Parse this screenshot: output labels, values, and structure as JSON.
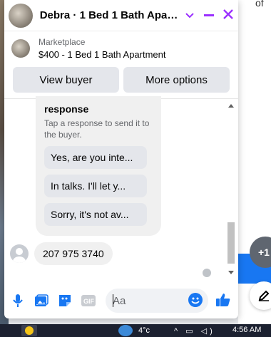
{
  "header": {
    "title": "Debra · 1 Bed 1 Bath Apart…"
  },
  "listing": {
    "label": "Marketplace",
    "title": "$400 - 1 Bed 1 Bath Apartment"
  },
  "actions": {
    "view_buyer": "View buyer",
    "more_options": "More options"
  },
  "bot_card": {
    "title": "response",
    "description": "Tap a response to send it to the buyer.",
    "replies": [
      "Yes, are you inte...",
      "In talks. I'll let y...",
      "Sorry, it's not av..."
    ]
  },
  "message": {
    "text": "207 975 3740"
  },
  "composer": {
    "placeholder": "Aa"
  },
  "right_panel": {
    "partial_text": "of",
    "new_badge": "+1"
  },
  "taskbar": {
    "temp": "4°c",
    "time": "4:56 AM"
  },
  "colors": {
    "accent": "#1877f2",
    "header_icons": "#9b30ff"
  },
  "icons": [
    "chevron-down-icon",
    "minimize-icon",
    "close-icon",
    "mic-icon",
    "photo-icon",
    "sticker-icon",
    "gif-icon",
    "emoji-icon",
    "like-icon",
    "compose-icon"
  ]
}
